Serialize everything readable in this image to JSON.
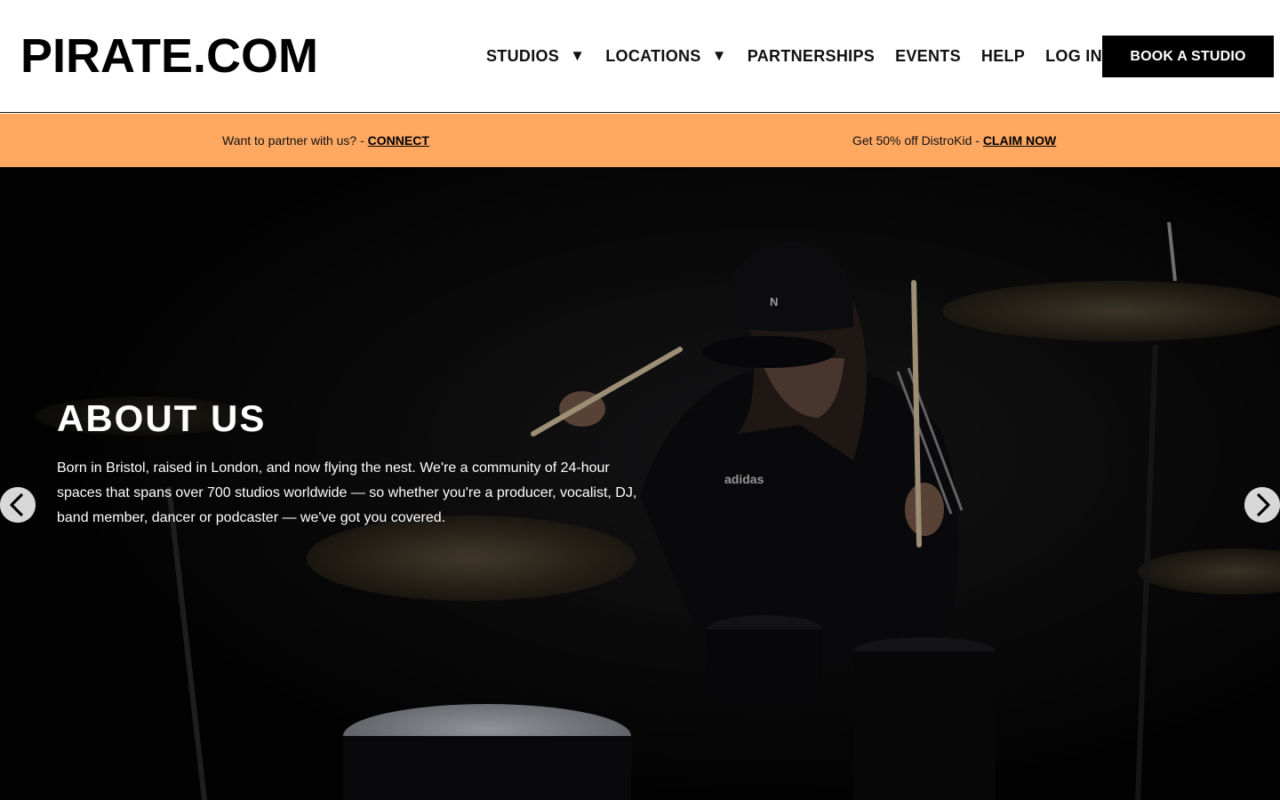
{
  "header": {
    "logo": "PIRATE.COM",
    "nav": [
      {
        "label": "STUDIOS",
        "caret": "▼"
      },
      {
        "label": "LOCATIONS",
        "caret": "▼"
      },
      {
        "label": "PARTNERSHIPS"
      },
      {
        "label": "EVENTS"
      },
      {
        "label": "HELP"
      },
      {
        "label": "LOG IN"
      }
    ],
    "cta": "BOOK A STUDIO"
  },
  "promo": {
    "left_text": "Want to partner with us? - ",
    "left_link": "CONNECT",
    "right_text": "Get 50% off DistroKid - ",
    "right_link": "CLAIM NOW",
    "background": "#ffa862"
  },
  "hero": {
    "title": "ABOUT US",
    "body": "Born in Bristol, raised in London, and now flying the nest. We're a community of 24-hour spaces that spans over 700 studios worldwide — so whether you're a producer, vocalist, DJ, band member, dancer or podcaster — we've got you covered.",
    "cap_letter": "N",
    "shirt_logo": "adidas",
    "prev_icon": "chevron-left-icon",
    "next_icon": "chevron-right-icon"
  }
}
